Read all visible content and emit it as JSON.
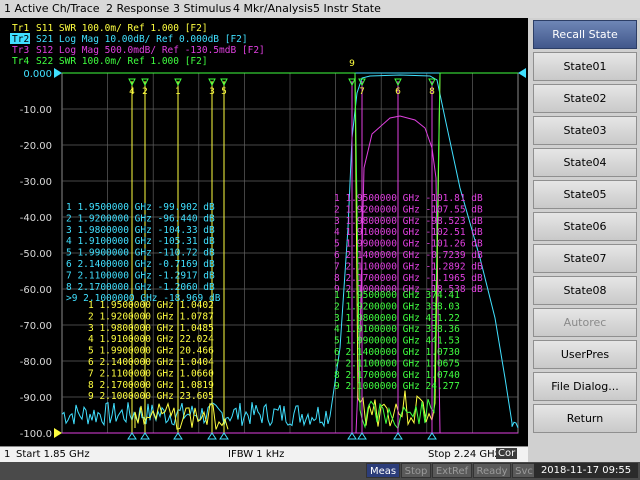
{
  "menu": [
    "1 Active Ch/Trace",
    "2 Response",
    "3 Stimulus",
    "4 Mkr/Analysis",
    "5 Instr State"
  ],
  "colors": {
    "tr1": "#ffff40",
    "tr2": "#40e0ff",
    "tr3": "#e040e0",
    "tr4": "#40ff40",
    "grid": "#606060"
  },
  "traces": [
    {
      "label": "Tr1",
      "text": "S11  SWR 100.0m/ Ref 1.000 [F2]"
    },
    {
      "label": "Tr2",
      "text": "S21 Log Mag 10.00dB/ Ref 0.000dB [F2]"
    },
    {
      "label": "Tr3",
      "text": "S12 Log Mag 500.0mdB/ Ref -130.5mdB [F2]"
    },
    {
      "label": "Tr4",
      "text": "S22  SWR 100.0m/ Ref 1.000 [F2]"
    }
  ],
  "y_labels": [
    "0.000",
    "-10.00",
    "-20.00",
    "-30.00",
    "-40.00",
    "-50.00",
    "-60.00",
    "-70.00",
    "-80.00",
    "-90.00",
    "-100.0"
  ],
  "markers_s21": [
    [
      "1",
      "1.9500000 GHz",
      "-99.902",
      "dB"
    ],
    [
      "2",
      "1.9200000 GHz",
      "-96.440",
      "dB"
    ],
    [
      "3",
      "1.9800000 GHz",
      "-104.33",
      "dB"
    ],
    [
      "4",
      "1.9100000 GHz",
      "-105.31",
      "dB"
    ],
    [
      "5",
      "1.9900000 GHz",
      "-110.72",
      "dB"
    ],
    [
      "6",
      "2.1400000 GHz",
      "-0.7169",
      "dB"
    ],
    [
      "7",
      "2.1100000 GHz",
      "-1.2917",
      "dB"
    ],
    [
      "8",
      "2.1700000 GHz",
      "-1.2060",
      "dB"
    ],
    [
      ">9",
      "2.1000000 GHz",
      "-18.969",
      "dB"
    ]
  ],
  "markers_s11": [
    [
      "1",
      "1.9500000 GHz",
      "1.0402"
    ],
    [
      "2",
      "1.9200000 GHz",
      "1.0787"
    ],
    [
      "3",
      "1.9800000 GHz",
      "1.0485"
    ],
    [
      "4",
      "1.9100000 GHz",
      "22.024"
    ],
    [
      "5",
      "1.9900000 GHz",
      "20.466"
    ],
    [
      "6",
      "2.1400000 GHz",
      "1.0404"
    ],
    [
      "7",
      "2.1100000 GHz",
      "1.0660"
    ],
    [
      "8",
      "2.1700000 GHz",
      "1.0819"
    ],
    [
      "9",
      "2.1000000 GHz",
      "23.605"
    ]
  ],
  "markers_s12": [
    [
      "1",
      "1.9500000 GHz",
      "-101.81",
      "dB"
    ],
    [
      "2",
      "1.9200000 GHz",
      "-107.55",
      "dB"
    ],
    [
      "3",
      "1.9800000 GHz",
      "-98.523",
      "dB"
    ],
    [
      "4",
      "1.9100000 GHz",
      "-102.51",
      "dB"
    ],
    [
      "5",
      "1.9900000 GHz",
      "-101.26",
      "dB"
    ],
    [
      "6",
      "2.1400000 GHz",
      "-0.7239",
      "dB"
    ],
    [
      "7",
      "2.1100000 GHz",
      "-1.2892",
      "dB"
    ],
    [
      "8",
      "2.1700000 GHz",
      "-1.1965",
      "dB"
    ],
    [
      "9",
      "2.1000000 GHz",
      "-18.538",
      "dB"
    ]
  ],
  "markers_s22": [
    [
      "1",
      "1.9500000 GHz",
      "374.41"
    ],
    [
      "2",
      "1.9200000 GHz",
      "338.03"
    ],
    [
      "3",
      "1.9800000 GHz",
      "431.22"
    ],
    [
      "4",
      "1.9100000 GHz",
      "338.36"
    ],
    [
      "5",
      "1.9900000 GHz",
      "441.53"
    ],
    [
      "6",
      "2.1400000 GHz",
      "1.0730"
    ],
    [
      "7",
      "2.1100000 GHz",
      "1.0675"
    ],
    [
      "8",
      "2.1700000 GHz",
      "1.0740"
    ],
    [
      "9",
      "2.1000000 GHz",
      "24.277"
    ]
  ],
  "plot_marker_numbers": [
    "4",
    "2",
    "1",
    "3",
    "5",
    "9",
    "7",
    "6",
    "8"
  ],
  "status": {
    "channel": "1",
    "start": "Start 1.85 GHz",
    "ifbw": "IFBW 1 kHz",
    "stop": "Stop 2.24 GHz",
    "cor": "Cor"
  },
  "sidebar": {
    "title": "Recall State",
    "buttons": [
      "State01",
      "State02",
      "State03",
      "State04",
      "State05",
      "State06",
      "State07",
      "State08",
      "Autorec",
      "UserPres",
      "File Dialog...",
      "Return"
    ]
  },
  "bottombar": {
    "items": [
      "Meas",
      "Stop",
      "ExtRef",
      "Ready",
      "Svc"
    ],
    "datetime": "2018-11-17 09:55"
  }
}
